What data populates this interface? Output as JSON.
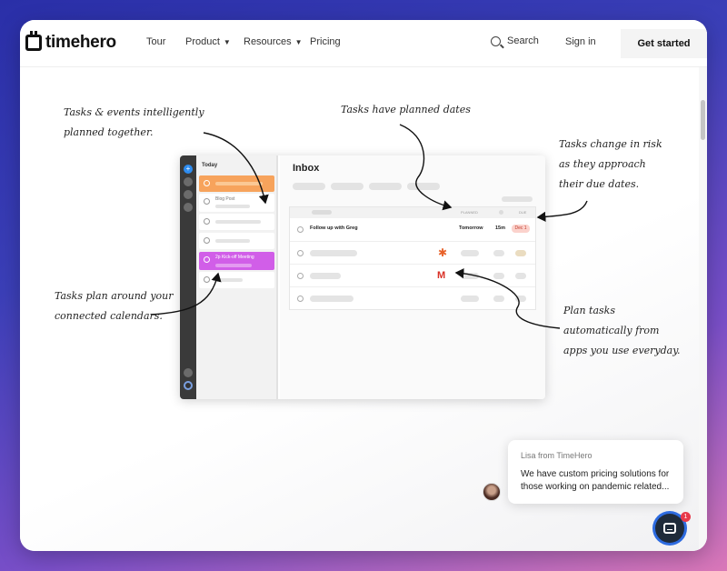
{
  "header": {
    "brand": "timehero",
    "nav": [
      {
        "label": "Tour"
      },
      {
        "label": "Product"
      },
      {
        "label": "Resources"
      },
      {
        "label": "Pricing"
      }
    ],
    "search_label": "Search",
    "signin_label": "Sign in",
    "cta_label": "Get started"
  },
  "annotations": {
    "planned_together_1": "Tasks & events intelligently",
    "planned_together_2": "planned together.",
    "planned_dates": "Tasks have planned dates",
    "risk_1": "Tasks change in risk",
    "risk_2": "as they approach",
    "risk_3": "their due dates.",
    "calendars_1": "Tasks plan around your",
    "calendars_2": "connected calendars.",
    "apps_1": "Plan tasks",
    "apps_2": "automatically from",
    "apps_3": "apps you use everyday."
  },
  "mock_app": {
    "add_icon": "+",
    "day_label": "Today",
    "slot_blog": "Blog Post",
    "slot_meeting": "2p  Kick-off Meeting",
    "inbox_title": "Inbox",
    "col_planned": "PLANNED",
    "col_due": "DUE",
    "task_name": "Follow up with Greg",
    "task_planned": "Tomorrow",
    "task_duration": "15m",
    "task_due": "Dec 1"
  },
  "chat": {
    "from": "Lisa from TimeHero",
    "message": "We have custom pricing solutions for those working on pandemic related...",
    "badge_count": "1"
  },
  "colors": {
    "accent_orange": "#f7a35c",
    "accent_magenta": "#d15ee8",
    "due_badge": "#fbd2cc",
    "launcher": "#1f2b3a"
  },
  "icons": [
    "calendar-logo-icon",
    "search-icon",
    "chevron-down-icon",
    "zapier-icon",
    "gmail-icon",
    "chat-icon"
  ]
}
